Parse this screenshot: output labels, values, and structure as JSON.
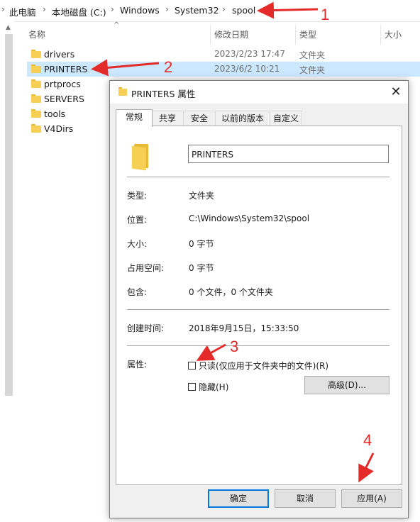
{
  "breadcrumb": {
    "items": [
      "此电脑",
      "本地磁盘 (C:)",
      "Windows",
      "System32",
      "spool"
    ],
    "separator": "›"
  },
  "list": {
    "headers": {
      "name": "名称",
      "date": "修改日期",
      "type": "类型",
      "size": "大小"
    },
    "rows": [
      {
        "name": "drivers",
        "date": "2023/2/23 17:47",
        "type": "文件夹"
      },
      {
        "name": "PRINTERS",
        "date": "2023/6/2 10:21",
        "type": "文件夹"
      },
      {
        "name": "prtprocs",
        "date": "",
        "type": ""
      },
      {
        "name": "SERVERS",
        "date": "",
        "type": ""
      },
      {
        "name": "tools",
        "date": "",
        "type": ""
      },
      {
        "name": "V4Dirs",
        "date": "",
        "type": ""
      }
    ]
  },
  "dialog": {
    "title": "PRINTERS 属性",
    "close_glyph": "✕",
    "tabs": [
      "常规",
      "共享",
      "安全",
      "以前的版本",
      "自定义"
    ],
    "folder_name": "PRINTERS",
    "props": {
      "type_label": "类型:",
      "type_value": "文件夹",
      "location_label": "位置:",
      "location_value": "C:\\Windows\\System32\\spool",
      "size_label": "大小:",
      "size_value": "0 字节",
      "disk_label": "占用空间:",
      "disk_value": "0 字节",
      "contains_label": "包含:",
      "contains_value": "0 个文件，0 个文件夹",
      "created_label": "创建时间:",
      "created_value": "2018年9月15日，15:33:50",
      "attr_label": "属性:"
    },
    "readonly_label": "只读(仅应用于文件夹中的文件)(R)",
    "hidden_label": "隐藏(H)",
    "advanced_label": "高级(D)...",
    "ok_label": "确定",
    "cancel_label": "取消",
    "apply_label": "应用(A)"
  },
  "annotations": [
    "1",
    "2",
    "3",
    "4"
  ],
  "colors": {
    "selection": "#cce8ff",
    "annotation": "#e52a2a",
    "accent": "#0078d7"
  }
}
